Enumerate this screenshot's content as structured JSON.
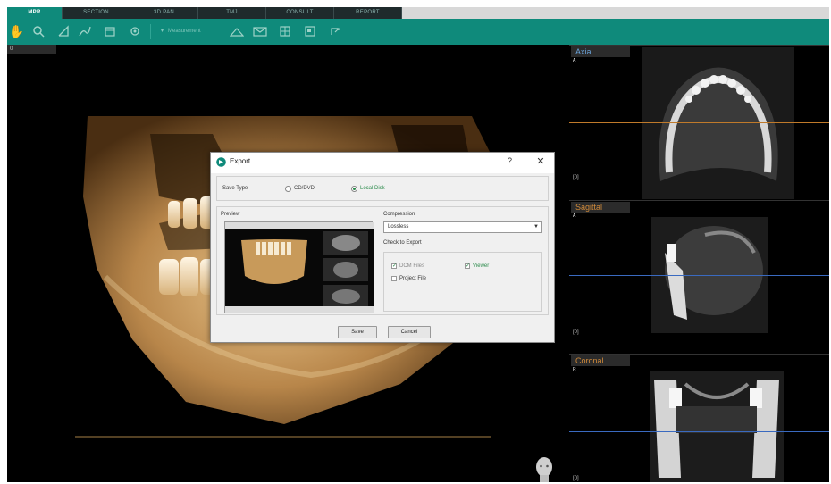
{
  "tabs": [
    "MPR",
    "SECTION",
    "3D PAN",
    "TMJ",
    "CONSULT",
    "REPORT"
  ],
  "toolbar": {
    "measure_label": "Measurement"
  },
  "panels": {
    "axial": {
      "title": "Axial",
      "corner": "A",
      "tag": "[0]"
    },
    "sagittal": {
      "title": "Sagittal",
      "corner": "A",
      "tag": "[0]"
    },
    "coronal": {
      "title": "Coronal",
      "corner": "R",
      "tag": "[0]"
    }
  },
  "dialog": {
    "title": "Export",
    "help": "?",
    "close": "✕",
    "save_type_label": "Save Type",
    "options": [
      "CD/DVD",
      "Local Disk"
    ],
    "selected_option": "Local Disk",
    "preview_label": "Preview",
    "compression_label": "Compression",
    "compression_value": "Lossless",
    "check_label": "Check to Export",
    "checks": [
      {
        "label": "DCM Files",
        "checked": true
      },
      {
        "label": "Viewer",
        "checked": true
      },
      {
        "label": "Project File",
        "checked": false
      }
    ],
    "save_button": "Save",
    "cancel_button": "Cancel"
  },
  "colors": {
    "accent": "#0f8a7b",
    "tab_dark": "#1f2a2c",
    "axial_title": "#6aa2d8",
    "orange_title": "#d08a3a",
    "crosshair_h": "#c07a2a",
    "crosshair_blue": "#3a6ac0"
  }
}
